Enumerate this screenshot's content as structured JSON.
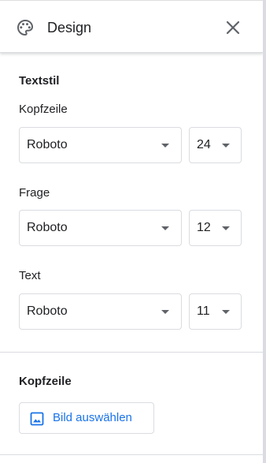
{
  "header": {
    "title": "Design",
    "icon": "palette-icon",
    "close_icon": "close-icon"
  },
  "text_style": {
    "section_title": "Textstil",
    "rows": [
      {
        "label": "Kopfzeile",
        "font": "Roboto",
        "size": "24"
      },
      {
        "label": "Frage",
        "font": "Roboto",
        "size": "12"
      },
      {
        "label": "Text",
        "font": "Roboto",
        "size": "11"
      }
    ]
  },
  "header_section": {
    "section_title": "Kopfzeile",
    "button_label": "Bild auswählen",
    "button_icon": "image-icon"
  },
  "colors": {
    "accent": "#1a73e8",
    "border": "#dadce0",
    "text": "#202124",
    "icon": "#5f6368"
  }
}
